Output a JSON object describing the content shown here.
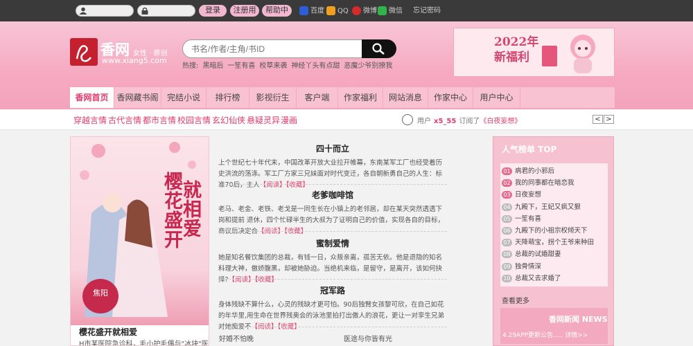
{
  "topbar": {
    "login_label": "登录",
    "register_label": "注册用户",
    "help_label": "帮助中心",
    "social": [
      "百度",
      "QQ",
      "微博",
      "微信",
      "忘记密码"
    ]
  },
  "header": {
    "logo_name": "香网",
    "logo_sub": "女性 · 原创",
    "logo_url": "www.xiang5.com",
    "search_placeholder": "书名/作者/主角/书ID",
    "hot_label": "热搜:",
    "hot_terms": [
      "黑暗后",
      "一笙有喜",
      "校草来袭",
      "神经丫头有点甜",
      "恶魔少爷别撩我"
    ],
    "banner_line1": "2022年",
    "banner_line2": "新福利"
  },
  "nav": {
    "tabs": [
      "香网首页",
      "香网藏书阁",
      "完结小说",
      "排行榜",
      "影视衍生",
      "客户端",
      "作家福利",
      "网站消息",
      "作家中心",
      "用户中心"
    ]
  },
  "subnav": {
    "links": [
      "穿越言情",
      "古代言情",
      "都市言情",
      "校园言情",
      "玄幻仙侠",
      "悬疑灵异",
      "漫画"
    ],
    "user_prefix": "用户",
    "user_name": "x5_55",
    "action": "订阅了",
    "book": "《白夜妄想》"
  },
  "cover": {
    "vertical_left": "樱花盛开",
    "vertical_right": "就相爱",
    "badge": "焦阳",
    "title": "樱花盛开就相爱",
    "desc": "H市某医院急诊科，毛小护毛偶与\"冰块\"医生韩"
  },
  "middle": {
    "items": [
      {
        "title": "四十而立",
        "body": "上个世纪七十年代末，中国改革开放大业拉开帷幕，东南某军工厂也经受着历史洪流的荡涤。军工厂方家三兄妹面对时代变迁，各自朝新勇自己的人生：标准70后，主人",
        "read": "【阅读】",
        "fav": "【收藏】"
      },
      {
        "title": "老爹咖啡馆",
        "body": "老马、老金、老铁、老戈是一同生长在小镇上的老邻居，却在某天突然透透下岗和提前 退休，四个忙碌半生的大叔为了证明自己的价值，实现各自的目标，商议后决定合",
        "read": "【阅读】",
        "fav": "【收藏】"
      },
      {
        "title": "蜜制爱情",
        "body": "她是知名餐饮集团的总裁，有钱一日，众叛亲离，孤苦无依。他是退隐的知名料理大神，傲娇腹黑，却被她胁迫。当绝机来临，是留守，是离开，该如何抉择?",
        "read": "【阅读】",
        "fav": "【收藏】"
      },
      {
        "title": "冠军路",
        "body": "身体残缺不算什么，心灵的残缺才更可怕。90后独臂女孩黎可欣，在自己如花的年华里,用生命在世界残奥会的泳池里拍打出傲人的浪花，更让一对孪生兄弟对她痴爱不",
        "read": "【阅读】",
        "fav": "【收藏】"
      }
    ],
    "bottom_left": "好婚不怕晚",
    "bottom_right": "医途与你皆有光"
  },
  "rank": {
    "title": "人气榜单 TOP",
    "items": [
      "病君的小邪后",
      "我的同事都在暗恋我",
      "日夜妄想",
      "九殿下，王妃又疯又狠",
      "一笙有喜",
      "九殿下的小祖宗权倾天下",
      "天降萌宝，拐个王爷来种田",
      "总裁的试婚甜妻",
      "独骨情深",
      "总裁又去求婚了"
    ],
    "numbers": [
      "01",
      "02",
      "03",
      "04",
      "05",
      "06",
      "07",
      "08",
      "09",
      "10"
    ],
    "more": "查看更多",
    "news_title": "香网新闻 NEWS",
    "news_line": "4.29APP更新公告.....  详情>>"
  },
  "colors": {
    "accent": "#e03c6c",
    "header_pink": "#f6a9c1",
    "topbar": "#3a3a3a"
  }
}
